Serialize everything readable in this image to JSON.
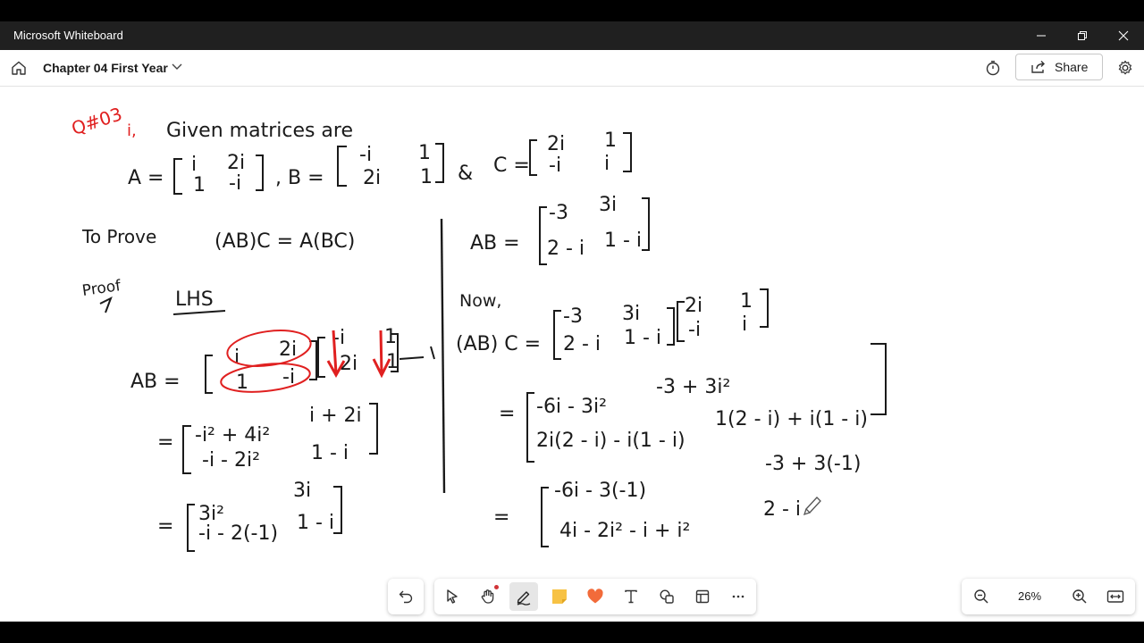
{
  "window": {
    "title": "Microsoft Whiteboard",
    "controls": [
      "minimize-icon",
      "restore-icon",
      "close-icon"
    ]
  },
  "appbar": {
    "board_name": "Chapter 04 First Year",
    "share_label": "Share",
    "icons": [
      "home-icon",
      "chevron-down-icon",
      "timer-icon",
      "share-icon",
      "gear-icon"
    ]
  },
  "colors": {
    "ink_black": "#1a1a1a",
    "ink_red": "#e02020",
    "titlebar": "#202020",
    "canvas": "#ffffff"
  },
  "canvas": {
    "ink_text": {
      "heading": "Q#03",
      "part": "i,",
      "given": "Given matrices are",
      "A_label": "A =",
      "A11": "i",
      "A12": "2i",
      "A21": "1",
      "A22": "-i",
      "B_label": ", B =",
      "B11": "-i",
      "B12": "1",
      "B21": "2i",
      "B22": "1",
      "and": "&",
      "C_label": "C =",
      "C11": "2i",
      "C12": "1",
      "C21": "-i",
      "C22": "i",
      "to_prove": "To Prove",
      "equation": "(AB)C  =  A(BC)",
      "proof": "Proof",
      "lhs": "LHS",
      "AB_label": "AB =",
      "ab_r1a": "i",
      "ab_r1b": "2i",
      "ab_r2a": "1",
      "ab_r2b": "-i",
      "ab2_r1a": "-i",
      "ab2_r1b": "1",
      "ab2_r2a": "2i",
      "ab2_r2b": "1",
      "eq": "=",
      "step2_r1a": "-i² + 4i²",
      "step2_r1b": "i + 2i",
      "step2_r2a": "-i - 2i²",
      "step2_r2b": "1 - i",
      "step3_r1a": "3i²",
      "step3_r1b": "3i",
      "step3_r2a": "-i - 2(-1)",
      "step3_r2b": "1 - i",
      "res_label": "AB =",
      "res_r1a": "-3",
      "res_r1b": "3i",
      "res_r2a": "2 - i",
      "res_r2b": "1 - i",
      "now": "Now,",
      "abc_label": "(AB) C =",
      "abc_m1_r1a": "-3",
      "abc_m1_r1b": "3i",
      "abc_m1_r2a": "2 - i",
      "abc_m1_r2b": "1 - i",
      "abc_m2_r1a": "2i",
      "abc_m2_r1b": "1",
      "abc_m2_r2a": "-i",
      "abc_m2_r2b": "i",
      "r2_r1a": "-6i - 3i²",
      "r2_r1b": "-3 + 3i²",
      "r2_r2a": "2i(2 - i) - i(1 - i)",
      "r2_r2b": "1(2 - i) + i(1 - i)",
      "r3_r1a": "-6i - 3(-1)",
      "r3_r1b": "-3 + 3(-1)",
      "r3_r2a": "4i - 2i² - i + i²",
      "r3_r2b": "2 - i"
    }
  },
  "toolbar": {
    "undo": "undo-icon",
    "tools": [
      "select-icon",
      "hand-icon",
      "pen-icon",
      "sticky-note-icon",
      "reactions-icon",
      "text-icon",
      "shapes-icon",
      "templates-icon",
      "more-icon"
    ],
    "active_tool": "pen-icon"
  },
  "zoom": {
    "level": "26%",
    "icons": [
      "zoom-out-icon",
      "zoom-in-icon",
      "fit-width-icon"
    ]
  }
}
